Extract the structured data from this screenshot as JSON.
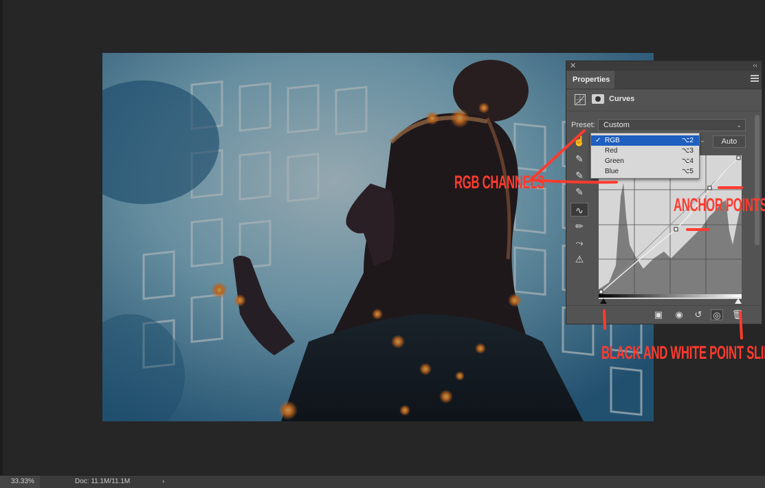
{
  "panel": {
    "close_glyph": "✕",
    "collapse_glyph": "‹‹",
    "tab_label": "Properties",
    "adjustment_title": "Curves",
    "preset_label": "Preset:",
    "preset_value": "Custom",
    "auto_label": "Auto"
  },
  "channel_menu": {
    "items": [
      {
        "label": "RGB",
        "shortcut": "⌥2",
        "checked": true
      },
      {
        "label": "Red",
        "shortcut": "⌥3",
        "checked": false
      },
      {
        "label": "Green",
        "shortcut": "⌥4",
        "checked": false
      },
      {
        "label": "Blue",
        "shortcut": "⌥5",
        "checked": false
      }
    ],
    "check_glyph": "✓"
  },
  "annotations": {
    "rgb_channels": "RGB CHANNELS",
    "anchor_points": "ANCHOR POINTS",
    "slider": "BLACK AND WHITE POINT SLIDER",
    "color": "#ff3b2f"
  },
  "status_bar": {
    "zoom": "33.33%",
    "doc": "Doc: 11.1M/11.1M",
    "arrow": "›"
  },
  "icons": {
    "hand_tool": "☝",
    "eyedropper": "✎",
    "curve_tool": "∿",
    "pencil_tool": "✏",
    "smooth_tool": "⤳",
    "clip_warning": "⚠",
    "clip_layer": "▣",
    "view_prev": "◉",
    "reset": "↺",
    "visibility": "◎",
    "trash": "🗑"
  }
}
